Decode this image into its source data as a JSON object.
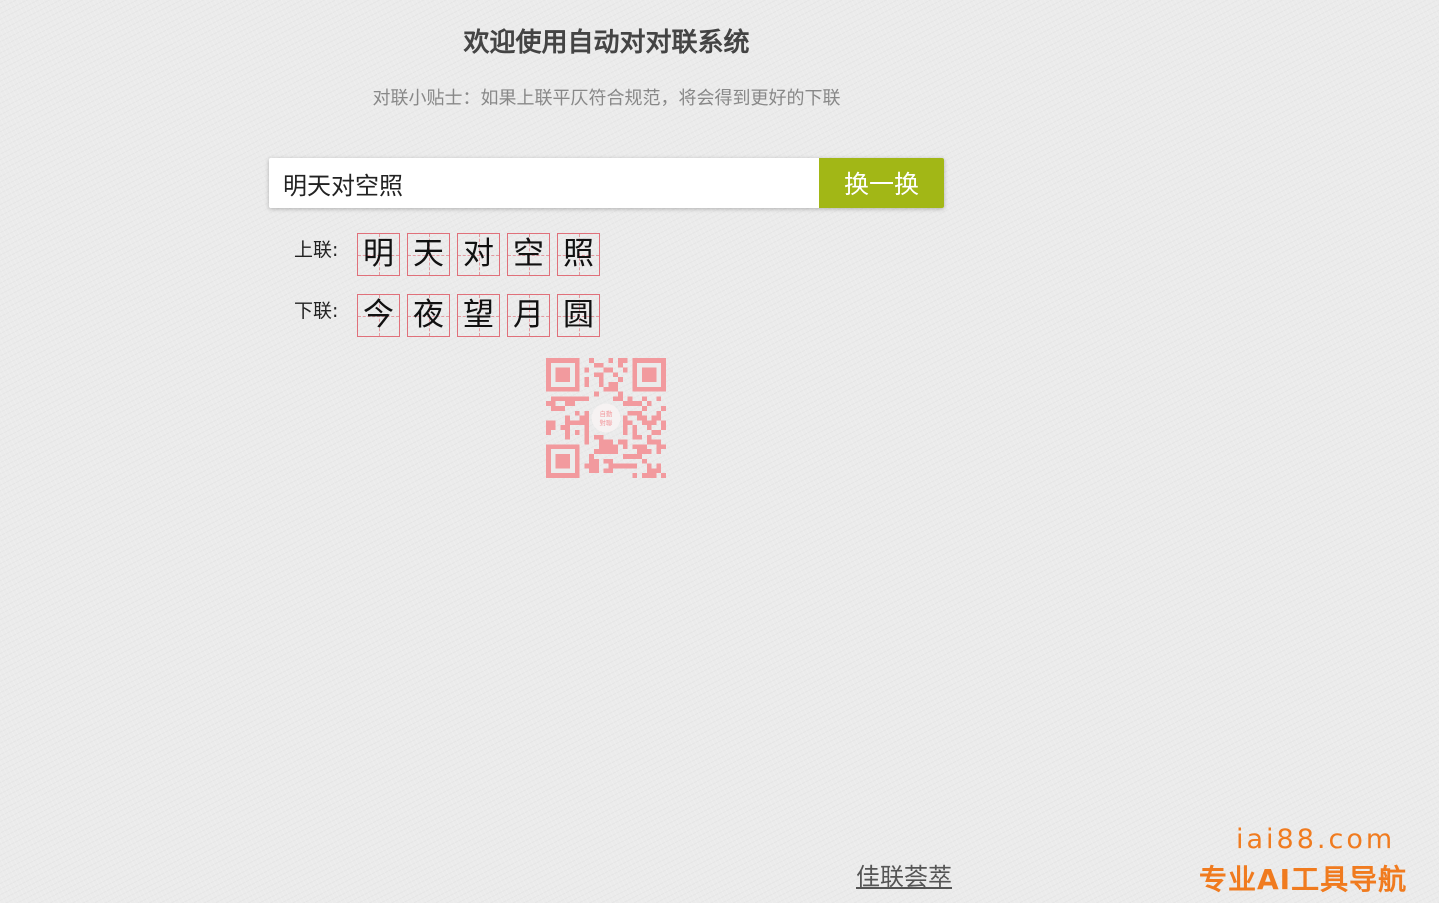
{
  "header": {
    "title": "欢迎使用自动对对联系统",
    "tip": "对联小贴士：如果上联平仄符合规范，将会得到更好的下联"
  },
  "search": {
    "value": "明天对空照",
    "button_label": "换一换"
  },
  "couplet": {
    "upper_label": "上联:",
    "upper_chars": [
      "明",
      "天",
      "对",
      "空",
      "照"
    ],
    "lower_label": "下联:",
    "lower_chars": [
      "今",
      "夜",
      "望",
      "月",
      "圆"
    ]
  },
  "qr": {
    "center_text": "自動對聯",
    "color": "#f29a9e"
  },
  "footer": {
    "link_label": "佳联荟萃"
  },
  "watermark": {
    "url": "iai88.com",
    "slogan": "专业AI工具导航",
    "color": "#f07b1f"
  },
  "colors": {
    "accent": "#a2b716",
    "grid_border": "#e0707a"
  }
}
